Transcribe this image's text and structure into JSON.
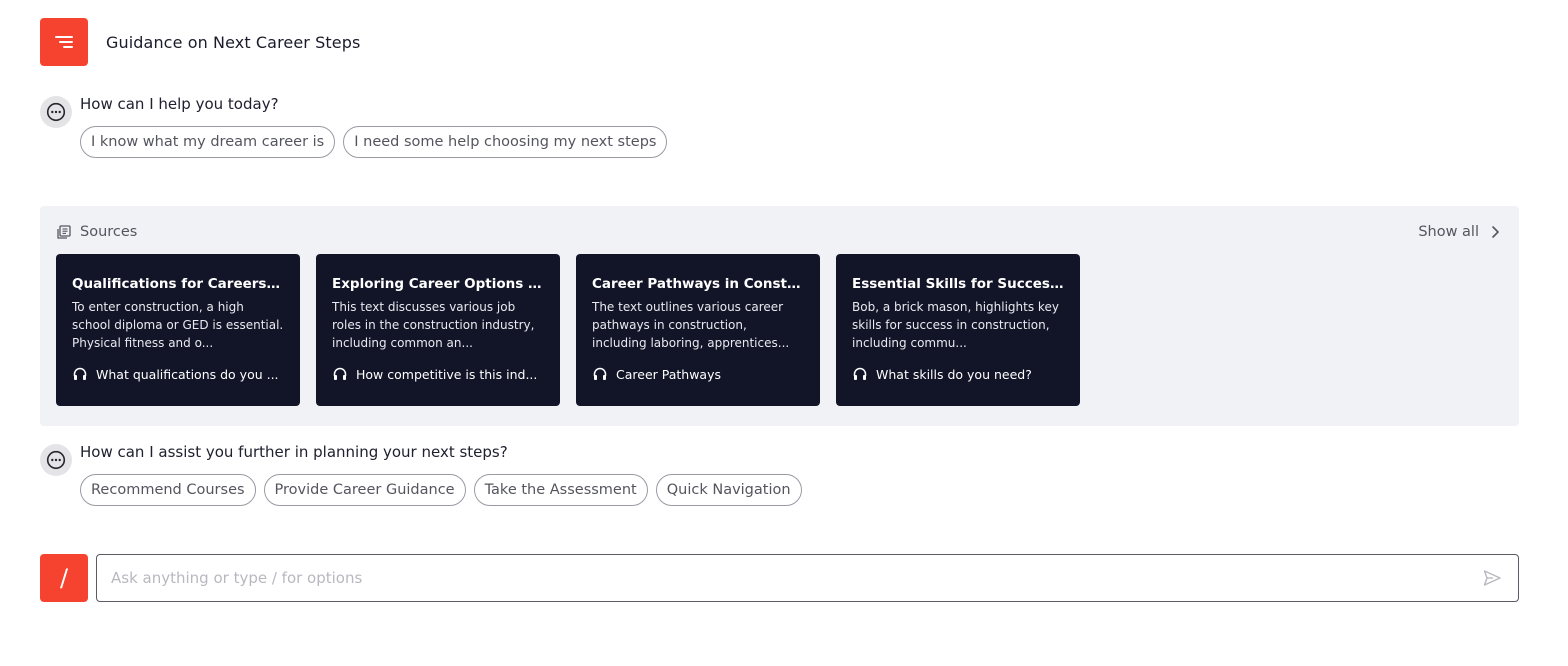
{
  "header": {
    "title": "Guidance on Next Career Steps",
    "menu_icon": "menu-icon"
  },
  "messages": [
    {
      "text": "How can I help you today?",
      "options": [
        "I know what my dream career is",
        "I need some help choosing my next steps"
      ]
    },
    {
      "text": "How can I assist you further in planning your next steps?",
      "options": [
        "Recommend Courses",
        "Provide Career Guidance",
        "Take the Assessment",
        "Quick Navigation"
      ]
    }
  ],
  "sources": {
    "label": "Sources",
    "show_all": "Show all",
    "cards": [
      {
        "title": "Qualifications for Careers i...",
        "description": "To enter construction, a high school diploma or GED is essential. Physical fitness and o...",
        "footer": "What qualifications do you ...",
        "footer_icon": "headphones-icon"
      },
      {
        "title": "Exploring Career Options in ...",
        "description": "This text discusses various job roles in the construction industry, including common an...",
        "footer": "How competitive is this ind...",
        "footer_icon": "headphones-icon"
      },
      {
        "title": "Career Pathways in Constr...",
        "description": "The text outlines various career pathways in construction, including laboring, apprentices...",
        "footer": "Career Pathways",
        "footer_icon": "headphones-icon"
      },
      {
        "title": "Essential Skills for Success i...",
        "description": "Bob, a brick mason, highlights key skills for success in construction, including commu...",
        "footer": "What skills do you need?",
        "footer_icon": "headphones-icon"
      }
    ]
  },
  "composer": {
    "slash_label": "/",
    "placeholder": "Ask anything or type / for options",
    "value": ""
  },
  "colors": {
    "accent": "#f5432f",
    "card_bg": "#121528",
    "sources_bg": "#f1f2f6"
  }
}
